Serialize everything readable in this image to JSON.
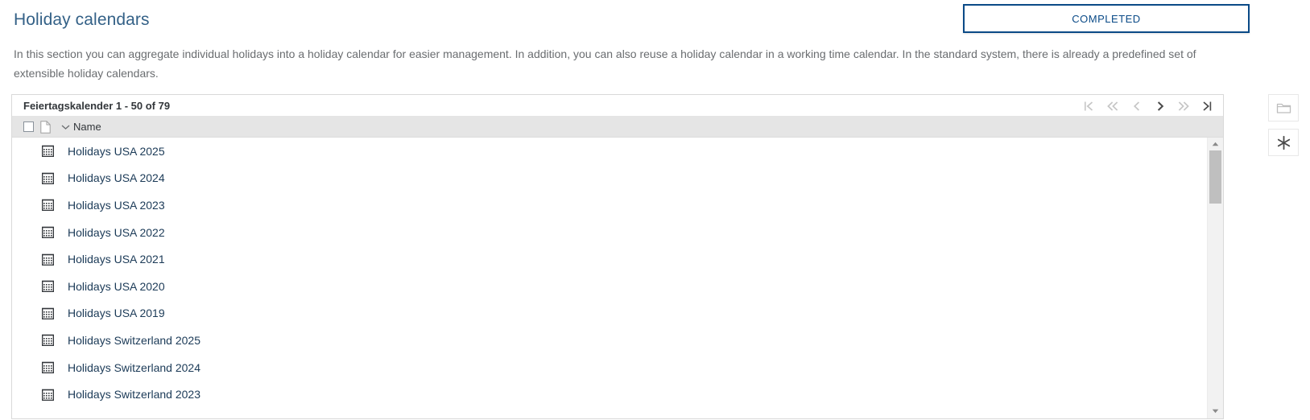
{
  "header": {
    "title": "Holiday calendars",
    "status_button": {
      "label": "COMPLETED",
      "border_color": "#0a4a87",
      "text_color": "#0a4a87"
    }
  },
  "description": "In this section you can aggregate individual holidays into a holiday calendar for easier management. In addition, you can also reuse a holiday calendar in a working time calendar. In the standard system, there is already a predefined set of extensible holiday calendars.",
  "table": {
    "title": "Feiertagskalender 1 - 50 of 79",
    "columns": [
      {
        "label": "Name",
        "sort_icon": "chevron-down-icon"
      }
    ],
    "select_all_checked": false,
    "pager": [
      {
        "name": "first-page",
        "glyph": "go-to-first",
        "enabled": false
      },
      {
        "name": "previous-page-group",
        "glyph": "double-left",
        "enabled": false
      },
      {
        "name": "previous-page",
        "glyph": "single-left",
        "enabled": false
      },
      {
        "name": "next-page",
        "glyph": "single-right",
        "enabled": true
      },
      {
        "name": "next-page-group",
        "glyph": "double-right",
        "enabled": false
      },
      {
        "name": "last-page",
        "glyph": "go-to-last",
        "enabled": true
      }
    ],
    "rows": [
      {
        "icon": "calendar-icon",
        "name": "Holidays USA 2025"
      },
      {
        "icon": "calendar-icon",
        "name": "Holidays USA 2024"
      },
      {
        "icon": "calendar-icon",
        "name": "Holidays USA 2023"
      },
      {
        "icon": "calendar-icon",
        "name": "Holidays USA 2022"
      },
      {
        "icon": "calendar-icon",
        "name": "Holidays USA 2021"
      },
      {
        "icon": "calendar-icon",
        "name": "Holidays USA 2020"
      },
      {
        "icon": "calendar-icon",
        "name": "Holidays USA 2019"
      },
      {
        "icon": "calendar-icon",
        "name": "Holidays Switzerland 2025"
      },
      {
        "icon": "calendar-icon",
        "name": "Holidays Switzerland 2024"
      },
      {
        "icon": "calendar-icon",
        "name": "Holidays Switzerland 2023"
      }
    ],
    "scrollbar": {
      "up_arrow": "triangle-up-icon",
      "down_arrow": "triangle-down-icon",
      "thumb_color": "#bfbfbf",
      "track_color": "#f2f2f2"
    }
  },
  "side_rail": [
    {
      "name": "folder-icon",
      "enabled": false
    },
    {
      "name": "asterisk-icon",
      "enabled": true
    }
  ],
  "colors": {
    "title_blue": "#346187",
    "link_navy": "#1b3a57",
    "body_grey": "#6a6d70",
    "header_grey": "#e5e5e5",
    "border_grey": "#d9d9d9"
  }
}
